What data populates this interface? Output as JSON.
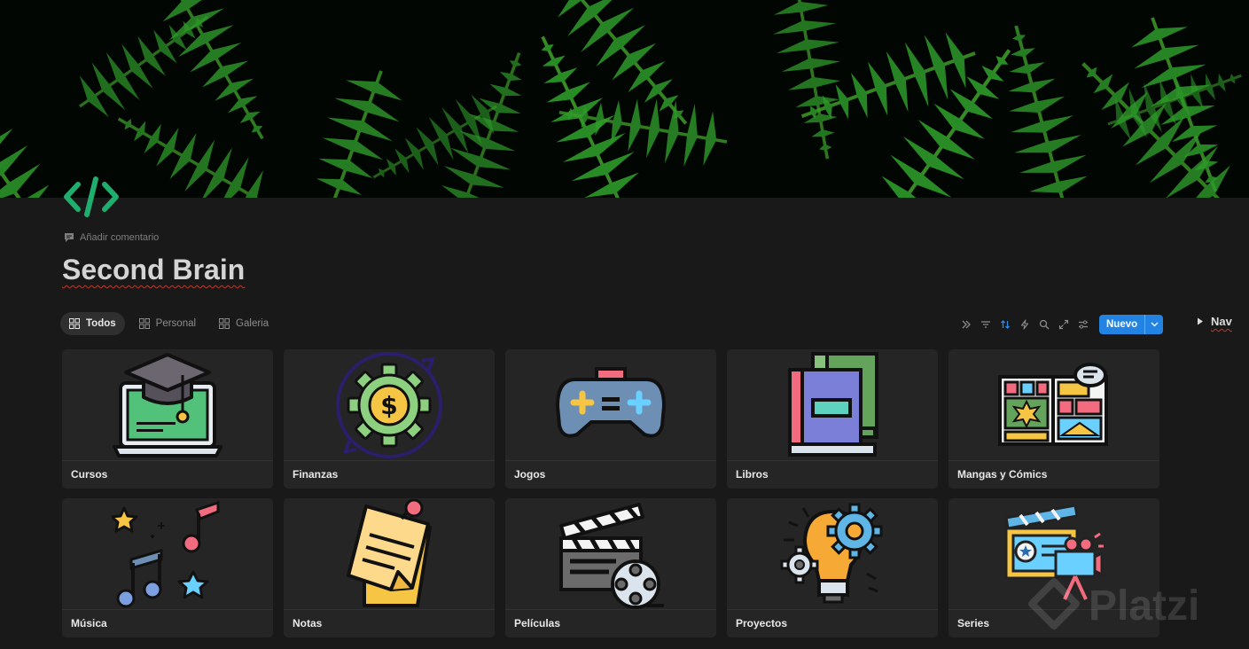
{
  "page": {
    "comment_label": "Añadir comentario",
    "title": "Second Brain"
  },
  "views": [
    {
      "label": "Todos",
      "active": true
    },
    {
      "label": "Personal",
      "active": false
    },
    {
      "label": "Galeria",
      "active": false
    }
  ],
  "toolbar": {
    "icons": [
      "expand-right-icon",
      "filter-icon",
      "sort-icon",
      "lightning-icon",
      "search-icon",
      "open-full-icon",
      "settings-sliders-icon"
    ],
    "new_label": "Nuevo",
    "accent": "#2383e2"
  },
  "sidebar_toggle": {
    "label": "Nav"
  },
  "cards": [
    {
      "label": "Cursos",
      "icon": "graduation-laptop-icon"
    },
    {
      "label": "Finanzas",
      "icon": "dollar-gear-icon"
    },
    {
      "label": "Jogos",
      "icon": "gamepad-icon"
    },
    {
      "label": "Libros",
      "icon": "books-icon"
    },
    {
      "label": "Mangas y Cómics",
      "icon": "comic-panels-icon"
    },
    {
      "label": "Música",
      "icon": "music-notes-icon"
    },
    {
      "label": "Notas",
      "icon": "sticky-note-icon"
    },
    {
      "label": "Películas",
      "icon": "clapperboard-icon"
    },
    {
      "label": "Proyectos",
      "icon": "bulb-gears-icon"
    },
    {
      "label": "Series",
      "icon": "film-camera-icon"
    }
  ],
  "watermark": {
    "text": "Platzi"
  },
  "colors": {
    "background": "#191919",
    "card": "#252525",
    "icon_green": "#1fae6d"
  }
}
